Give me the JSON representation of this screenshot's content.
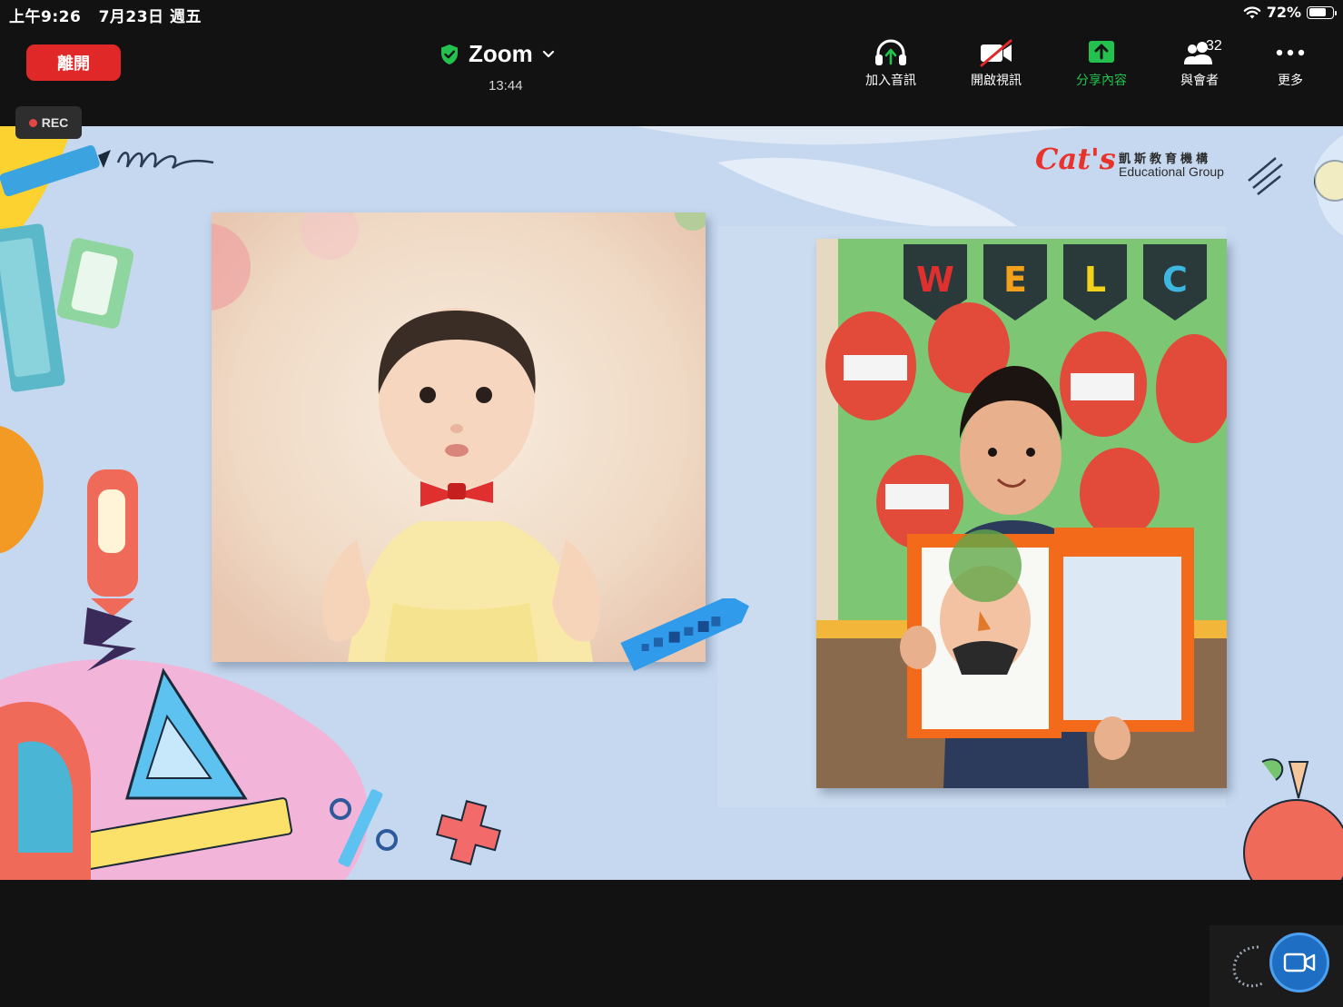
{
  "status_bar": {
    "time": "上午9:26",
    "date": "7月23日 週五",
    "battery": "72%",
    "battery_level": 0.72
  },
  "toolbar": {
    "leave_label": "離開",
    "meeting_title": "Zoom",
    "meeting_timer": "13:44",
    "join_audio_label": "加入音訊",
    "start_video_label": "開啟視訊",
    "share_label": "分享內容",
    "participants_label": "與會者",
    "participants_count": "32",
    "more_label": "更多"
  },
  "recording": {
    "label": "REC"
  },
  "shared_content": {
    "logo_brand": "Cat's",
    "logo_cn": "凱斯教育機構",
    "logo_en": "Educational Group",
    "welcome_letters": [
      "W",
      "E",
      "L",
      "C"
    ]
  },
  "colors": {
    "leave": "#e02828",
    "share_green": "#25c14f",
    "rec_dot": "#e24646",
    "video_fab": "#1e6fc4"
  }
}
